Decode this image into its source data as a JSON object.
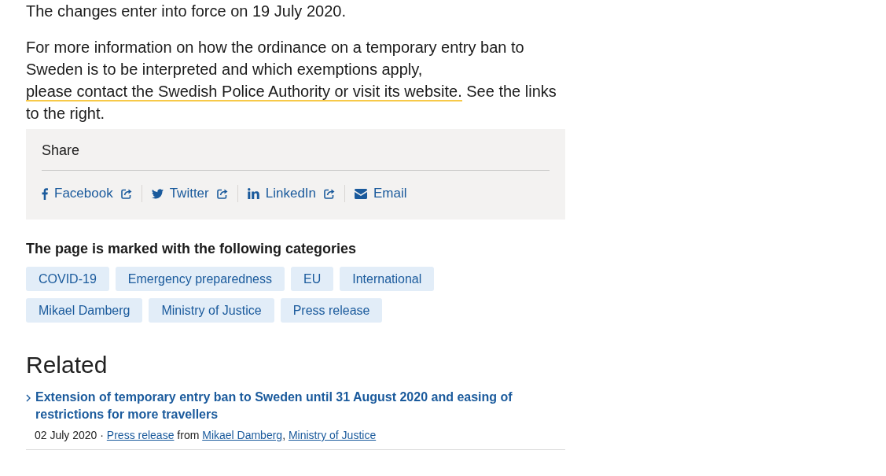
{
  "paragraphs": [
    {
      "kind": "plain",
      "text": "The changes enter into force on 19 July 2020."
    },
    {
      "kind": "linked",
      "text_before": "For more information on how the ordinance on a temporary entry ban to Sweden is to be interpreted and which exemptions apply, ",
      "link": "please contact the Swedish Police Authority or visit its website.",
      "text_after": " See the links to the right."
    }
  ],
  "share": {
    "title": "Share",
    "links": [
      {
        "kind": "facebook",
        "label": "Facebook",
        "external": true
      },
      {
        "kind": "twitter",
        "label": "Twitter",
        "external": true
      },
      {
        "kind": "linkedin",
        "label": "LinkedIn",
        "external": true
      },
      {
        "kind": "email",
        "label": "Email",
        "external": false
      }
    ]
  },
  "categories": {
    "title": "The page is marked with the following categories",
    "tags": [
      "COVID-19",
      "Emergency preparedness",
      "EU",
      "International",
      "Mikael Damberg",
      "Ministry of Justice",
      "Press release"
    ]
  },
  "related": {
    "title": "Related",
    "items": [
      {
        "title": "Extension of temporary entry ban to Sweden until 31 August 2020 and easing of restrictions for more travellers",
        "date": "02 July 2020",
        "separator": "·",
        "type": "Press release",
        "from": "from",
        "authors": [
          "Mikael Damberg",
          "Ministry of Justice"
        ],
        "author_separator": ","
      }
    ]
  }
}
